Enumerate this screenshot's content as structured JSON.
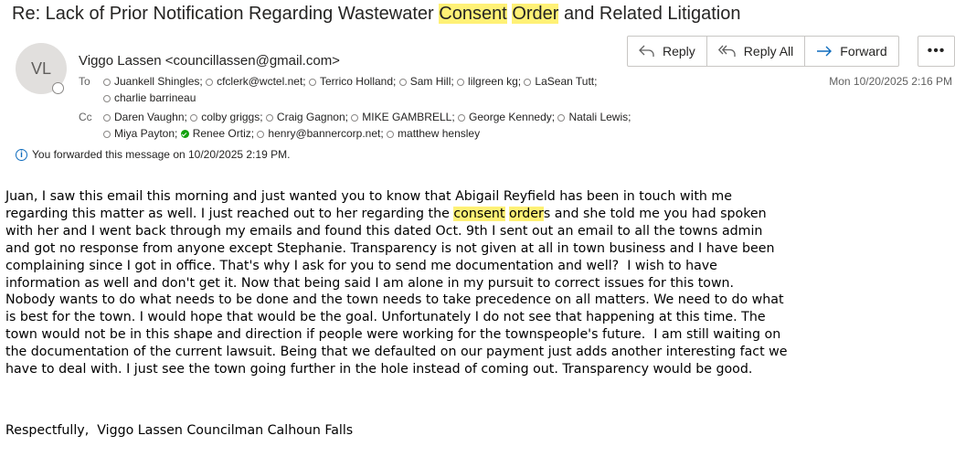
{
  "subject": {
    "before": "Re: Lack of Prior Notification Regarding Wastewater ",
    "hl1": "Consent",
    "mid": " ",
    "hl2": "Order",
    "after": " and Related Litigation"
  },
  "sender": {
    "initials": "VL",
    "display": "Viggo Lassen <councillassen@gmail.com>"
  },
  "to": {
    "label": "To",
    "line1": [
      "Juankell Shingles;",
      "cfclerk@wctel.net;",
      "Terrico Holland;",
      "Sam Hill;",
      "lilgreen kg;",
      "LaSean Tutt;"
    ],
    "line2": [
      "charlie barrineau"
    ]
  },
  "cc": {
    "label": "Cc",
    "line1": [
      "Daren Vaughn;",
      "colby griggs;",
      "Craig Gagnon;",
      "MIKE GAMBRELL;",
      "George Kennedy;",
      "Natali Lewis;"
    ],
    "line2_a": "Miya Payton;",
    "line2_b": "Renee Ortiz;",
    "line2_c": "henry@bannercorp.net;",
    "line2_d": "matthew hensley"
  },
  "date": "Mon 10/20/2025 2:16 PM",
  "actions": {
    "reply": "Reply",
    "reply_all": "Reply All",
    "forward": "Forward",
    "more": "•••"
  },
  "info": {
    "icon": "i",
    "text": "You forwarded this message on 10/20/2025 2:19 PM."
  },
  "body": {
    "p1": "Juan, I saw this email this morning and just wanted you to know that Abigail Reyfield has been in touch with me\nregarding this matter as well. I just reached out to her regarding the ",
    "hl1": "consent",
    "sp": " ",
    "hl2": "order",
    "p2": "s and she told me you had spoken\nwith her and I went back through my emails and found this dated Oct. 9th I sent out an email to all the towns admin\nand got no response from anyone except Stephanie. Transparency is not given at all in town business and I have been\ncomplaining since I got in office. That's why I ask for you to send me documentation and well?  I wish to have\ninformation as well and don't get it. Now that being said I am alone in my pursuit to correct issues for this town.\nNobody wants to do what needs to be done and the town needs to take precedence on all matters. We need to do what\nis best for the town. I would hope that would be the goal. Unfortunately I do not see that happening at this time. The\ntown would not be in this shape and direction if people were working for the townspeople's future.  I am still waiting on\nthe documentation of the current lawsuit. Being that we defaulted on our payment just adds another interesting fact we\nhave to deal with. I just see the town going further in the hole instead of coming out. Transparency would be good.",
    "signature": "Respectfully,  Viggo Lassen Councilman Calhoun Falls"
  },
  "colors": {
    "highlight": "#fff176",
    "accent": "#0f6cbd",
    "presence_ok": "#13a10e"
  }
}
